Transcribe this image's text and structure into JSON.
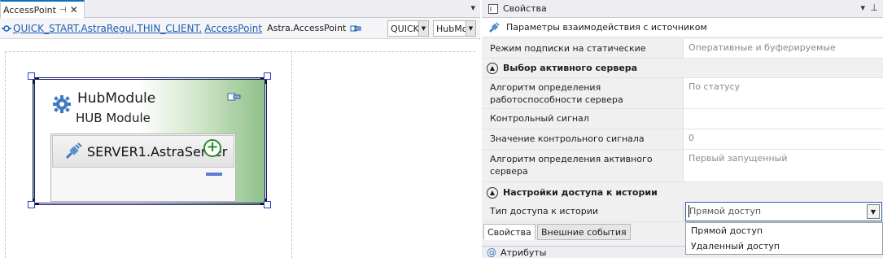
{
  "doc_tab": {
    "title": "AccessPoint",
    "pin_glyph": "⊣",
    "close_glyph": "✕"
  },
  "doc_menu_glyph": "▾",
  "breadcrumb": {
    "path_link": "QUICK_START.AstraRegul.THIN_CLIENT.",
    "current_link": "AccessPoint",
    "type_label": "Astra.AccessPoint"
  },
  "combos": {
    "quick": "QUICK_",
    "hub": "HubMo"
  },
  "module": {
    "title": "HubModule",
    "subtitle": "HUB Module",
    "server_label": "SERVER1.AstraServer",
    "plus_glyph": "+"
  },
  "properties": {
    "title": "Свойства",
    "subtitle": "Параметры взаимодействия с источником",
    "rows_top": [
      {
        "name": "Режим подписки на статические сигналы",
        "value": "Оперативные и буферируемые"
      }
    ],
    "category_active_server": "Выбор активного сервера",
    "rows_active": [
      {
        "name": "Алгоритм определения работоспособности сервера",
        "value": "По статусу"
      },
      {
        "name": "Контрольный сигнал",
        "value": ""
      },
      {
        "name": "Значение контрольного сигнала",
        "value": "0"
      },
      {
        "name": "Алгоритм определения активного сервера",
        "value": "Первый запущенный"
      }
    ],
    "category_history": "Настройки доступа к истории",
    "history_row": {
      "name": "Тип доступа к истории",
      "value": "Прямой доступ"
    },
    "dropdown_options": [
      "Прямой доступ",
      "Удаленный доступ"
    ],
    "bottom_tabs": [
      "Свойства",
      "Внешние события"
    ],
    "attributes_header": "Атрибуты",
    "collapse_glyph": "▲"
  },
  "colors": {
    "accent_link": "#1a5fb4",
    "selection_handle": "#2a3fd6",
    "module_gradient_end": "#8fc18a",
    "plus_green": "#2e8b2e"
  }
}
